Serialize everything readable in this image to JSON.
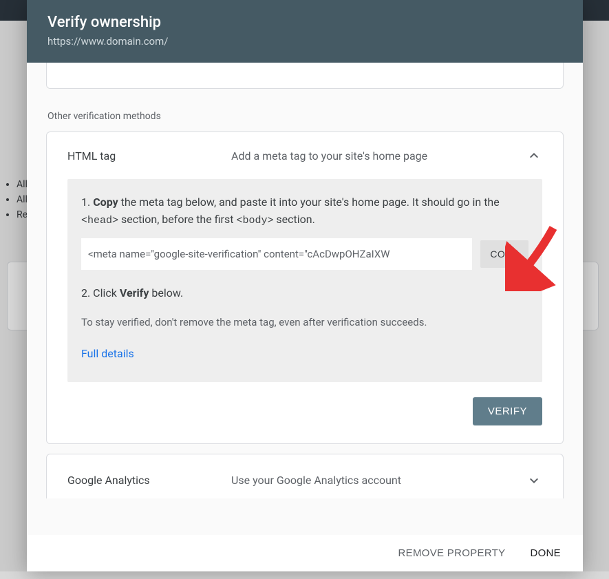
{
  "header": {
    "title": "Verify ownership",
    "subtitle": "https://www.domain.com/"
  },
  "sectionLabel": "Other verification methods",
  "htmlTag": {
    "title": "HTML tag",
    "desc": "Add a meta tag to your site's home page",
    "step1_prefix": "1. ",
    "step1_bold": "Copy",
    "step1_mid": " the meta tag below, and paste it into your site's home page. It should go in the ",
    "step1_code1": "<head>",
    "step1_mid2": " section, before the first ",
    "step1_code2": "<body>",
    "step1_suffix": " section.",
    "metaValue": "<meta name=\"google-site-verification\" content=\"cAcDwpOHZaIXW",
    "copyLabel": "COPY",
    "step2_prefix": "2. Click ",
    "step2_bold": "Verify",
    "step2_suffix": " below.",
    "stayNote": "To stay verified, don't remove the meta tag, even after verification succeeds.",
    "fullDetails": "Full details",
    "verifyLabel": "VERIFY"
  },
  "analytics": {
    "title": "Google Analytics",
    "desc": "Use your Google Analytics account"
  },
  "footer": {
    "remove": "REMOVE PROPERTY",
    "done": "DONE"
  },
  "bg": {
    "li1": "All",
    "li2": "All",
    "li3": "Re"
  }
}
